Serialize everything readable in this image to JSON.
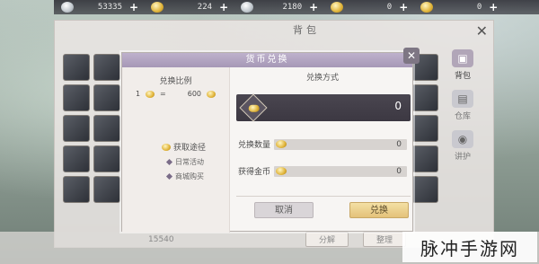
{
  "top_currencies": [
    {
      "icon": "silver-coin-icon",
      "value": "53335"
    },
    {
      "icon": "gold-coin-icon",
      "value": "224"
    },
    {
      "icon": "silver-ingot-icon",
      "value": "2180"
    },
    {
      "icon": "gold-ingot-icon",
      "value": "0"
    },
    {
      "icon": "gold-ingot-icon",
      "value": "0"
    }
  ],
  "bag": {
    "title": "背包",
    "side_tabs": [
      {
        "label": "背包",
        "active": true
      },
      {
        "label": "仓库",
        "active": false
      },
      {
        "label": "讲护",
        "active": false
      }
    ],
    "bottom_money": "15540",
    "bottom_actions": [
      "分解",
      "整理"
    ]
  },
  "dialog": {
    "title": "货币兑换",
    "left": {
      "ratio_title": "兑换比例",
      "ratio_left": "1",
      "ratio_equals": "=",
      "ratio_right": "600",
      "path_title": "获取途径",
      "path_options": [
        "日常活动",
        "商城购买"
      ]
    },
    "right": {
      "method_title": "兑换方式",
      "exchange_amount": "0",
      "qty_label": "兑换数量",
      "qty_value": "0",
      "gain_label": "获得金币",
      "gain_value": "0",
      "cancel_label": "取消",
      "confirm_label": "兑换"
    }
  },
  "watermark": "脉冲手游网",
  "colors": {
    "accent_header": "#b3a6c2",
    "confirm_gold": "#e8c67f",
    "dark_box": "#433f49"
  }
}
